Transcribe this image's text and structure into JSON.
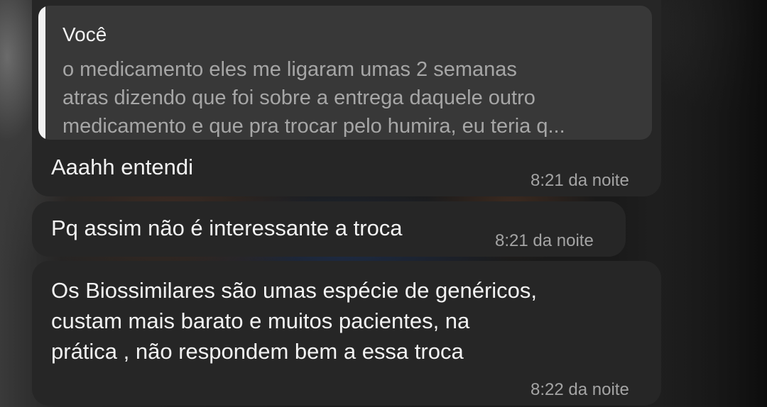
{
  "chat": {
    "messages": [
      {
        "reply_quote": {
          "author": "Você",
          "lines": [
            "o medicamento eles me ligaram umas 2 semanas",
            "atras dizendo que foi sobre a entrega daquele outro",
            "medicamento e que pra trocar pelo humira, eu teria q..."
          ]
        },
        "lines": [
          "Aaahh entendi"
        ],
        "time": "8:21 da noite"
      },
      {
        "lines": [
          "Pq assim não é interessante a troca"
        ],
        "time": "8:21 da noite"
      },
      {
        "lines": [
          "Os Biossimilares são umas espécie de genéricos,",
          "custam mais barato e muitos pacientes, na",
          "prática , não respondem bem a essa troca"
        ],
        "time": "8:22 da noite"
      }
    ]
  },
  "colors": {
    "bubble": "#262626",
    "quote_background": "#383838",
    "quote_bar": "#f2f2f2",
    "message_text": "#f2f2f2",
    "quote_text": "#a6a6a6",
    "timestamp": "#a4a4a4"
  }
}
